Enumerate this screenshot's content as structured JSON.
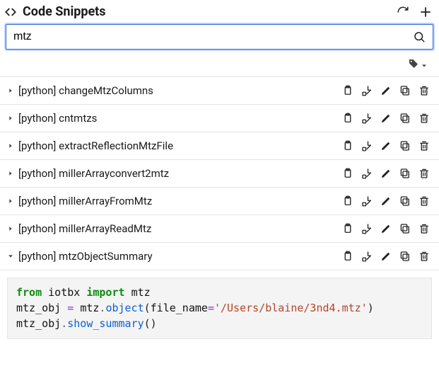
{
  "header": {
    "title": "Code Snippets"
  },
  "search": {
    "value": "mtz",
    "placeholder": ""
  },
  "items": [
    {
      "expanded": false,
      "lang": "[python]",
      "name": "changeMtzColumns"
    },
    {
      "expanded": false,
      "lang": "[python]",
      "name": "cntmtzs"
    },
    {
      "expanded": false,
      "lang": "[python]",
      "name": "extractReflectionMtzFile"
    },
    {
      "expanded": false,
      "lang": "[python]",
      "name": "millerArrayconvert2mtz"
    },
    {
      "expanded": false,
      "lang": "[python]",
      "name": "millerArrayFromMtz"
    },
    {
      "expanded": false,
      "lang": "[python]",
      "name": "millerArrayReadMtz"
    },
    {
      "expanded": true,
      "lang": "[python]",
      "name": "mtzObjectSummary"
    }
  ],
  "code": {
    "l1_kw1": "from",
    "l1_mod": "iotbx",
    "l1_kw2": "import",
    "l1_imp": "mtz",
    "l2_lhs": "mtz_obj",
    "l2_eq": "=",
    "l2_rcv": "mtz",
    "l2_dot1": ".",
    "l2_fn": "object",
    "l2_lp": "(",
    "l2_argn": "file_name",
    "l2_aeq": "=",
    "l2_str": "'/Users/blaine/3nd4.mtz'",
    "l2_rp": ")",
    "l3_rcv": "mtz_obj",
    "l3_dot": ".",
    "l3_fn": "show_summary",
    "l3_lp": "(",
    "l3_rp": ")"
  }
}
